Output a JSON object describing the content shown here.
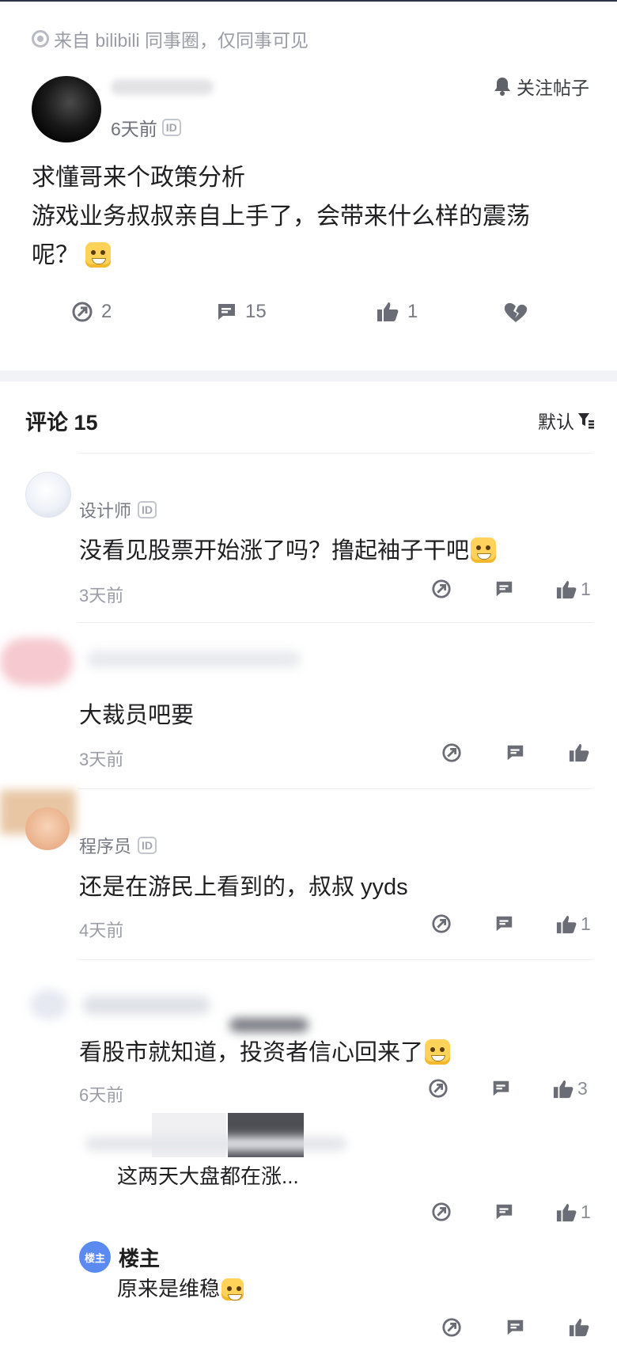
{
  "post": {
    "source_text": "来自 bilibili 同事圈，仅同事可见",
    "time": "6天前",
    "id_badge": "ID",
    "follow_label": "关注帖子",
    "text_line1": "求懂哥来个政策分析",
    "text_line2": "游戏业务叔叔亲自上手了，会带来什么样的震荡",
    "text_line3": "呢？",
    "actions": {
      "share_count": "2",
      "comment_count": "15",
      "like_count": "1"
    }
  },
  "comments_section": {
    "title": "评论 15",
    "sort_label": "默认",
    "comments": [
      {
        "name": "设计师",
        "id_badge": "ID",
        "text": "没看见股票开始涨了吗？撸起袖子干吧",
        "time": "3天前",
        "likes": "1"
      },
      {
        "name": "",
        "text": "大裁员吧要",
        "time": "3天前",
        "likes": ""
      },
      {
        "name": "程序员",
        "id_badge": "ID",
        "text": "还是在游民上看到的，叔叔 yyds",
        "time": "4天前",
        "likes": "1"
      },
      {
        "name": "",
        "text": "看股市就知道，投资者信心回来了",
        "time": "6天前",
        "likes": "3"
      }
    ],
    "reply1": {
      "text": "这两天大盘都在涨...",
      "likes": "1"
    },
    "reply2": {
      "badge": "楼主",
      "name": "楼主",
      "text": "原来是维稳"
    }
  },
  "colors": {
    "accent_blue": "#5b8af0",
    "text_primary": "#1f1f22",
    "text_muted": "#9a9da6"
  }
}
